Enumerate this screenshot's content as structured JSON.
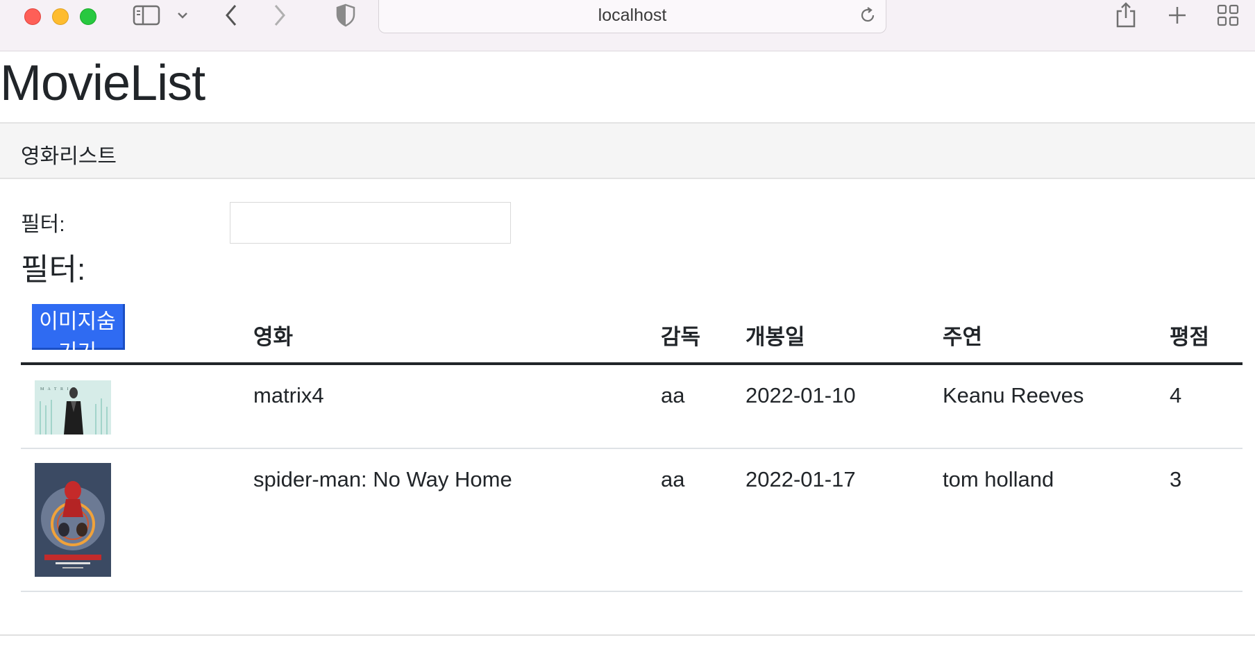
{
  "browser": {
    "address": "localhost"
  },
  "page": {
    "title": "MovieList",
    "nav_brand": "영화리스트",
    "filter_label": "필터:",
    "filter_value": "",
    "filter_heading": "필터:",
    "toggle_button": "이미지숨기기"
  },
  "table": {
    "headers": [
      "영화",
      "감독",
      "개봉일",
      "주연",
      "평점"
    ],
    "rows": [
      {
        "poster": "matrix4 poster",
        "title": "matrix4",
        "director": "aa",
        "release": "2022-01-10",
        "star": "Keanu Reeves",
        "rating": "4"
      },
      {
        "poster": "spider-man poster",
        "title": "spider-man: No Way Home",
        "director": "aa",
        "release": "2022-01-17",
        "star": "tom holland",
        "rating": "3"
      }
    ]
  },
  "colors": {
    "button_bg": "#2f6bf2",
    "navbar_bg": "#f5f5f5",
    "chrome_bg": "#f6f1f6"
  }
}
